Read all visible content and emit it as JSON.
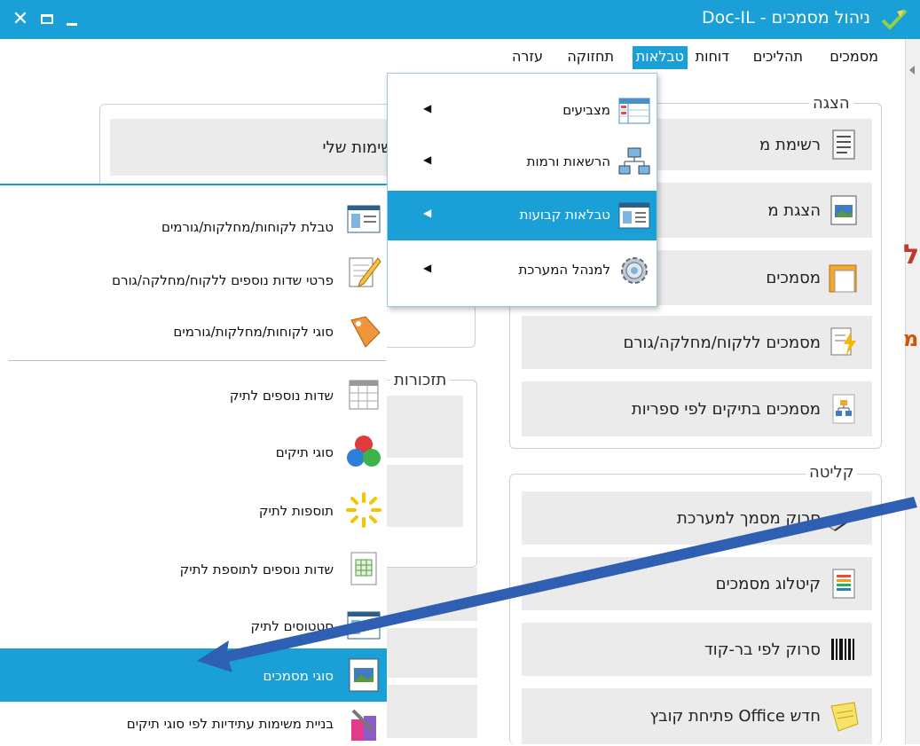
{
  "window": {
    "title": "ניהול מסמכים - Doc-IL",
    "controls": {
      "close": "✕",
      "maximize": "□",
      "minimize": "_"
    }
  },
  "menubar": {
    "items": [
      {
        "label": "מסמכים"
      },
      {
        "label": "תהליכים"
      },
      {
        "label": "דוחות"
      },
      {
        "label": "טבלאות",
        "active": true
      },
      {
        "label": "תחזוקה"
      },
      {
        "label": "עזרה"
      }
    ]
  },
  "dropdown": {
    "items": [
      {
        "label": "מצביעים",
        "icon": "table-grid-icon"
      },
      {
        "label": "הרשאות ורמות",
        "icon": "network-computers-icon"
      },
      {
        "label": "טבלאות קבועות",
        "icon": "form-window-icon",
        "active": true
      },
      {
        "label": "למנהל המערכת",
        "icon": "gear-icon"
      }
    ]
  },
  "submenu": {
    "items": [
      {
        "label": "טבלת לקוחות/מחלקות/גורמים",
        "icon": "form-window-icon"
      },
      {
        "label": "פרטי שדות נוספים ללקוח/מחלקה/גורם",
        "icon": "notepad-pencil-icon"
      },
      {
        "label": "סוגי לקוחות/מחלקות/גורמים",
        "icon": "tag-icon"
      },
      {
        "label": "שדות נוספים לתיק",
        "icon": "spreadsheet-icon"
      },
      {
        "label": "סוגי תיקים",
        "icon": "colored-balls-icon"
      },
      {
        "label": "תוספות לתיק",
        "icon": "sparkle-icon"
      },
      {
        "label": "שדות נוספים לתוספת לתיק",
        "icon": "grid-document-icon"
      },
      {
        "label": "סטטוסים לתיק",
        "icon": "form-window-icon"
      },
      {
        "label": "סוגי מסמכים",
        "icon": "image-document-icon",
        "active": true
      },
      {
        "label": "בניית משימות עתידיות לפי סוגי תיקים",
        "icon": "tools-icon"
      }
    ]
  },
  "display_group": {
    "label": "הצגה",
    "tiles": [
      {
        "label": "רשימת מ"
      },
      {
        "label": "הצגת מ"
      },
      {
        "label": "מסמכים"
      },
      {
        "label": "מסמכים ללקוח/מחלקה/גורם"
      },
      {
        "label": "מסמכים בתיקים לפי ספריות"
      }
    ]
  },
  "intake_group": {
    "label": "קליטה",
    "tiles": [
      {
        "label": "סרוק מסמך למערכת"
      },
      {
        "label": "קיטלוג מסמכים"
      },
      {
        "label": "סרוק לפי בר-קוד"
      },
      {
        "label": "חדש Office פתיחת קובץ"
      }
    ]
  },
  "tasks_panel": {
    "tile_label": "המשימות שלי"
  },
  "reminders_group": {
    "label": "תזכורות"
  },
  "edge_fragments": [
    "ל",
    "מ"
  ],
  "colors": {
    "accent": "#1a9fd6",
    "annotation_arrow": "#2f5fb3"
  }
}
